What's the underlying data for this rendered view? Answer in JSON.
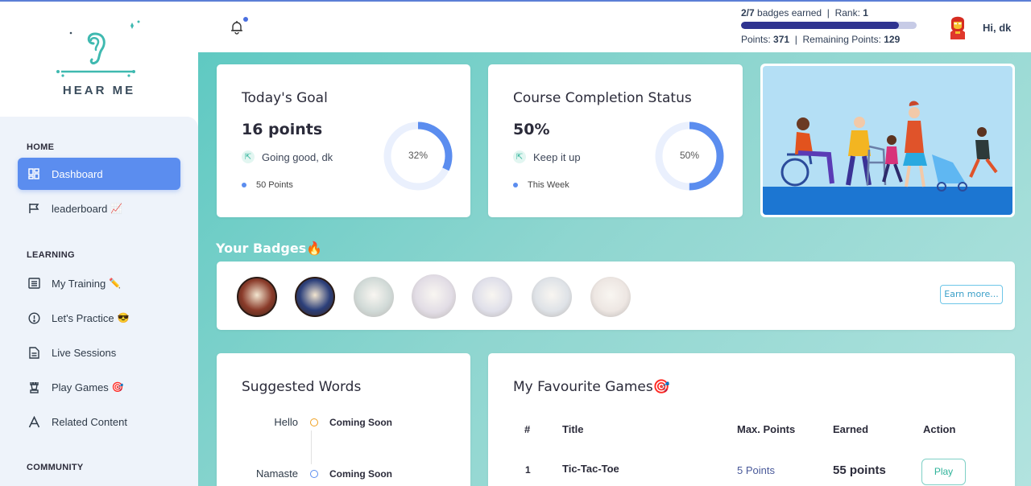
{
  "app": {
    "name": "HEAR ME"
  },
  "sidebar": {
    "sections": {
      "home": "HOME",
      "learning": "LEARNING",
      "community": "COMMUNITY"
    },
    "items": [
      {
        "label": "Dashboard",
        "emoji": "",
        "icon": "grid-icon"
      },
      {
        "label": "leaderboard",
        "emoji": "📈",
        "icon": "flag-icon"
      },
      {
        "label": "My Training",
        "emoji": "✏️",
        "icon": "list-icon"
      },
      {
        "label": "Let's Practice",
        "emoji": "😎",
        "icon": "alert-circle-icon"
      },
      {
        "label": "Live Sessions",
        "emoji": "",
        "icon": "document-icon"
      },
      {
        "label": "Play Games",
        "emoji": "🎯",
        "icon": "chess-rook-icon"
      },
      {
        "label": "Related Content",
        "emoji": "",
        "icon": "letter-a-icon"
      }
    ]
  },
  "header": {
    "badges_earned": "2/7",
    "badges_text": "badges earned",
    "rank_label": "Rank:",
    "rank": "1",
    "points_label": "Points:",
    "points": "371",
    "remaining_label": "Remaining Points:",
    "remaining": "129",
    "greeting": "Hi,  dk",
    "progress": 0.9
  },
  "goal": {
    "title": "Today's Goal",
    "value": "16 points",
    "trend": "Going good, dk",
    "sub": "50 Points",
    "percent_label": "32%",
    "percent": 32
  },
  "completion": {
    "title": "Course Completion Status",
    "value": "50%",
    "trend": "Keep it up",
    "sub": "This Week",
    "percent_label": "50%",
    "percent": 50
  },
  "badges": {
    "title": "Your Badges",
    "emoji": "🔥",
    "earn_more": "Earn more...",
    "items": [
      {
        "name": "eagle",
        "earned": true,
        "color": "#8a3b2a"
      },
      {
        "name": "owl",
        "earned": true,
        "color": "#2b3f7a"
      },
      {
        "name": "falcon",
        "earned": false,
        "color": "#6f9b8d"
      },
      {
        "name": "owl-large",
        "earned": false,
        "color": "#b39bc4"
      },
      {
        "name": "owl-portrait",
        "earned": false,
        "color": "#a6a6d6"
      },
      {
        "name": "hawk",
        "earned": false,
        "color": "#9db0c7"
      },
      {
        "name": "phoenix",
        "earned": false,
        "color": "#d8b8a5"
      }
    ]
  },
  "words": {
    "title": "Suggested Words",
    "items": [
      {
        "word": "Hello",
        "status": "Coming Soon",
        "color": "#f0a020"
      },
      {
        "word": "Namaste",
        "status": "Coming Soon",
        "color": "#5b8def"
      }
    ]
  },
  "games": {
    "title": "My Favourite Games",
    "emoji": "🎯",
    "columns": [
      "#",
      "Title",
      "Max. Points",
      "Earned",
      "Action"
    ],
    "rows": [
      {
        "num": "1",
        "title": "Tic-Tac-Toe",
        "max": "5 Points",
        "earned": "55 points",
        "action": "Play"
      }
    ]
  }
}
